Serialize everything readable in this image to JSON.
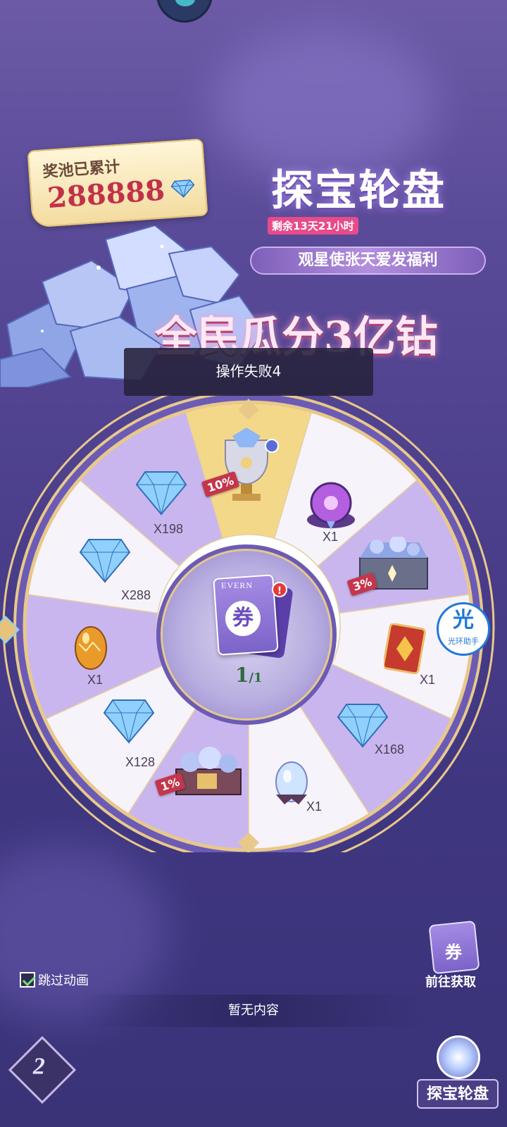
{
  "jackpot": {
    "title": "奖池已累计",
    "value": "288888"
  },
  "event": {
    "title": "探宝轮盘",
    "countdown": "剩余13天21小时",
    "subtitle": "观星使张天爱发福利",
    "slogan": "全民瓜分3亿钻"
  },
  "toast": {
    "message": "操作失败4"
  },
  "wheel": {
    "segments": [
      {
        "label": "",
        "badge": "10%",
        "icon": "trophy-icon"
      },
      {
        "label": "X1",
        "icon": "purple-orb-icon"
      },
      {
        "label": "",
        "badge": "3%",
        "icon": "treasure-chest-icon"
      },
      {
        "label": "X1",
        "icon": "card-icon"
      },
      {
        "label": "X168",
        "icon": "diamond-icon"
      },
      {
        "label": "X1",
        "icon": "crystal-egg-icon"
      },
      {
        "label": "",
        "badge": "1%",
        "icon": "gem-chest-icon"
      },
      {
        "label": "X128",
        "icon": "diamond-icon"
      },
      {
        "label": "X1",
        "icon": "golden-egg-icon"
      },
      {
        "label": "X288",
        "icon": "diamond-icon"
      },
      {
        "label": "X198",
        "icon": "diamond-icon"
      }
    ],
    "center": {
      "ticket_brand": "EVERN",
      "ticket_char": "券",
      "alert": "!",
      "count_current": "1",
      "count_total": "/1"
    }
  },
  "assist_badge": {
    "glyph": "光",
    "label": "光环助手"
  },
  "controls": {
    "skip_animation": "跳过动画",
    "skip_checked": true,
    "get_tickets": "前往获取",
    "get_ticket_char": "券",
    "get_ticket_brand": "EVERN"
  },
  "status_bar": {
    "text": "暂无内容"
  },
  "nav": {
    "logo_char": "2",
    "current": "探宝轮盘"
  },
  "colors": {
    "background": "#4c3f8c",
    "wheel_light": "#f7f3fb",
    "wheel_purple": "#c9b6ee",
    "wheel_gold": "#f4d88a",
    "badge_red": "#c4364b"
  }
}
